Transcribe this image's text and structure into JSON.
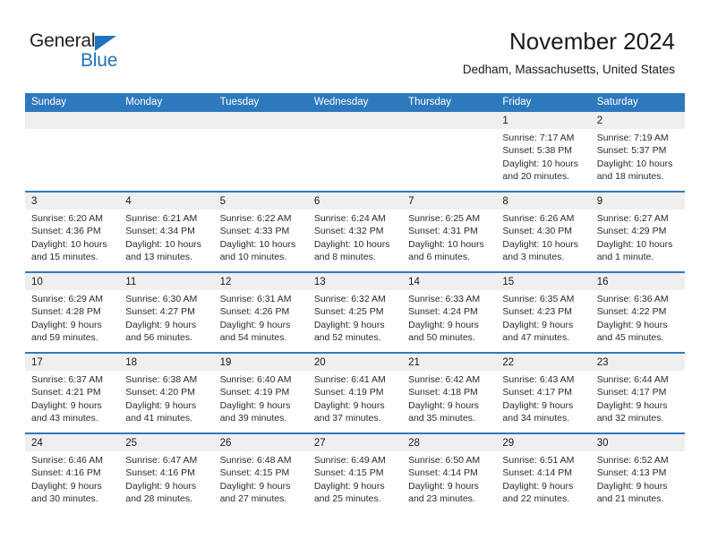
{
  "brand": {
    "name_top": "General",
    "name_bottom": "Blue",
    "accent_color": "#1f72bd"
  },
  "header": {
    "title": "November 2024",
    "location": "Dedham, Massachusetts, United States"
  },
  "theme": {
    "header_bar": "#2e79bd",
    "date_band": "#efefef",
    "separator": "#2e79bd",
    "text": "#1a1a1a"
  },
  "weekdays": [
    "Sunday",
    "Monday",
    "Tuesday",
    "Wednesday",
    "Thursday",
    "Friday",
    "Saturday"
  ],
  "weeks": [
    [
      {
        "day": "",
        "empty": true
      },
      {
        "day": "",
        "empty": true
      },
      {
        "day": "",
        "empty": true
      },
      {
        "day": "",
        "empty": true
      },
      {
        "day": "",
        "empty": true
      },
      {
        "day": "1",
        "sunrise": "Sunrise: 7:17 AM",
        "sunset": "Sunset: 5:38 PM",
        "daylight1": "Daylight: 10 hours",
        "daylight2": "and 20 minutes."
      },
      {
        "day": "2",
        "sunrise": "Sunrise: 7:19 AM",
        "sunset": "Sunset: 5:37 PM",
        "daylight1": "Daylight: 10 hours",
        "daylight2": "and 18 minutes."
      }
    ],
    [
      {
        "day": "3",
        "sunrise": "Sunrise: 6:20 AM",
        "sunset": "Sunset: 4:36 PM",
        "daylight1": "Daylight: 10 hours",
        "daylight2": "and 15 minutes."
      },
      {
        "day": "4",
        "sunrise": "Sunrise: 6:21 AM",
        "sunset": "Sunset: 4:34 PM",
        "daylight1": "Daylight: 10 hours",
        "daylight2": "and 13 minutes."
      },
      {
        "day": "5",
        "sunrise": "Sunrise: 6:22 AM",
        "sunset": "Sunset: 4:33 PM",
        "daylight1": "Daylight: 10 hours",
        "daylight2": "and 10 minutes."
      },
      {
        "day": "6",
        "sunrise": "Sunrise: 6:24 AM",
        "sunset": "Sunset: 4:32 PM",
        "daylight1": "Daylight: 10 hours",
        "daylight2": "and 8 minutes."
      },
      {
        "day": "7",
        "sunrise": "Sunrise: 6:25 AM",
        "sunset": "Sunset: 4:31 PM",
        "daylight1": "Daylight: 10 hours",
        "daylight2": "and 6 minutes."
      },
      {
        "day": "8",
        "sunrise": "Sunrise: 6:26 AM",
        "sunset": "Sunset: 4:30 PM",
        "daylight1": "Daylight: 10 hours",
        "daylight2": "and 3 minutes."
      },
      {
        "day": "9",
        "sunrise": "Sunrise: 6:27 AM",
        "sunset": "Sunset: 4:29 PM",
        "daylight1": "Daylight: 10 hours",
        "daylight2": "and 1 minute."
      }
    ],
    [
      {
        "day": "10",
        "sunrise": "Sunrise: 6:29 AM",
        "sunset": "Sunset: 4:28 PM",
        "daylight1": "Daylight: 9 hours",
        "daylight2": "and 59 minutes."
      },
      {
        "day": "11",
        "sunrise": "Sunrise: 6:30 AM",
        "sunset": "Sunset: 4:27 PM",
        "daylight1": "Daylight: 9 hours",
        "daylight2": "and 56 minutes."
      },
      {
        "day": "12",
        "sunrise": "Sunrise: 6:31 AM",
        "sunset": "Sunset: 4:26 PM",
        "daylight1": "Daylight: 9 hours",
        "daylight2": "and 54 minutes."
      },
      {
        "day": "13",
        "sunrise": "Sunrise: 6:32 AM",
        "sunset": "Sunset: 4:25 PM",
        "daylight1": "Daylight: 9 hours",
        "daylight2": "and 52 minutes."
      },
      {
        "day": "14",
        "sunrise": "Sunrise: 6:33 AM",
        "sunset": "Sunset: 4:24 PM",
        "daylight1": "Daylight: 9 hours",
        "daylight2": "and 50 minutes."
      },
      {
        "day": "15",
        "sunrise": "Sunrise: 6:35 AM",
        "sunset": "Sunset: 4:23 PM",
        "daylight1": "Daylight: 9 hours",
        "daylight2": "and 47 minutes."
      },
      {
        "day": "16",
        "sunrise": "Sunrise: 6:36 AM",
        "sunset": "Sunset: 4:22 PM",
        "daylight1": "Daylight: 9 hours",
        "daylight2": "and 45 minutes."
      }
    ],
    [
      {
        "day": "17",
        "sunrise": "Sunrise: 6:37 AM",
        "sunset": "Sunset: 4:21 PM",
        "daylight1": "Daylight: 9 hours",
        "daylight2": "and 43 minutes."
      },
      {
        "day": "18",
        "sunrise": "Sunrise: 6:38 AM",
        "sunset": "Sunset: 4:20 PM",
        "daylight1": "Daylight: 9 hours",
        "daylight2": "and 41 minutes."
      },
      {
        "day": "19",
        "sunrise": "Sunrise: 6:40 AM",
        "sunset": "Sunset: 4:19 PM",
        "daylight1": "Daylight: 9 hours",
        "daylight2": "and 39 minutes."
      },
      {
        "day": "20",
        "sunrise": "Sunrise: 6:41 AM",
        "sunset": "Sunset: 4:19 PM",
        "daylight1": "Daylight: 9 hours",
        "daylight2": "and 37 minutes."
      },
      {
        "day": "21",
        "sunrise": "Sunrise: 6:42 AM",
        "sunset": "Sunset: 4:18 PM",
        "daylight1": "Daylight: 9 hours",
        "daylight2": "and 35 minutes."
      },
      {
        "day": "22",
        "sunrise": "Sunrise: 6:43 AM",
        "sunset": "Sunset: 4:17 PM",
        "daylight1": "Daylight: 9 hours",
        "daylight2": "and 34 minutes."
      },
      {
        "day": "23",
        "sunrise": "Sunrise: 6:44 AM",
        "sunset": "Sunset: 4:17 PM",
        "daylight1": "Daylight: 9 hours",
        "daylight2": "and 32 minutes."
      }
    ],
    [
      {
        "day": "24",
        "sunrise": "Sunrise: 6:46 AM",
        "sunset": "Sunset: 4:16 PM",
        "daylight1": "Daylight: 9 hours",
        "daylight2": "and 30 minutes."
      },
      {
        "day": "25",
        "sunrise": "Sunrise: 6:47 AM",
        "sunset": "Sunset: 4:16 PM",
        "daylight1": "Daylight: 9 hours",
        "daylight2": "and 28 minutes."
      },
      {
        "day": "26",
        "sunrise": "Sunrise: 6:48 AM",
        "sunset": "Sunset: 4:15 PM",
        "daylight1": "Daylight: 9 hours",
        "daylight2": "and 27 minutes."
      },
      {
        "day": "27",
        "sunrise": "Sunrise: 6:49 AM",
        "sunset": "Sunset: 4:15 PM",
        "daylight1": "Daylight: 9 hours",
        "daylight2": "and 25 minutes."
      },
      {
        "day": "28",
        "sunrise": "Sunrise: 6:50 AM",
        "sunset": "Sunset: 4:14 PM",
        "daylight1": "Daylight: 9 hours",
        "daylight2": "and 23 minutes."
      },
      {
        "day": "29",
        "sunrise": "Sunrise: 6:51 AM",
        "sunset": "Sunset: 4:14 PM",
        "daylight1": "Daylight: 9 hours",
        "daylight2": "and 22 minutes."
      },
      {
        "day": "30",
        "sunrise": "Sunrise: 6:52 AM",
        "sunset": "Sunset: 4:13 PM",
        "daylight1": "Daylight: 9 hours",
        "daylight2": "and 21 minutes."
      }
    ]
  ]
}
